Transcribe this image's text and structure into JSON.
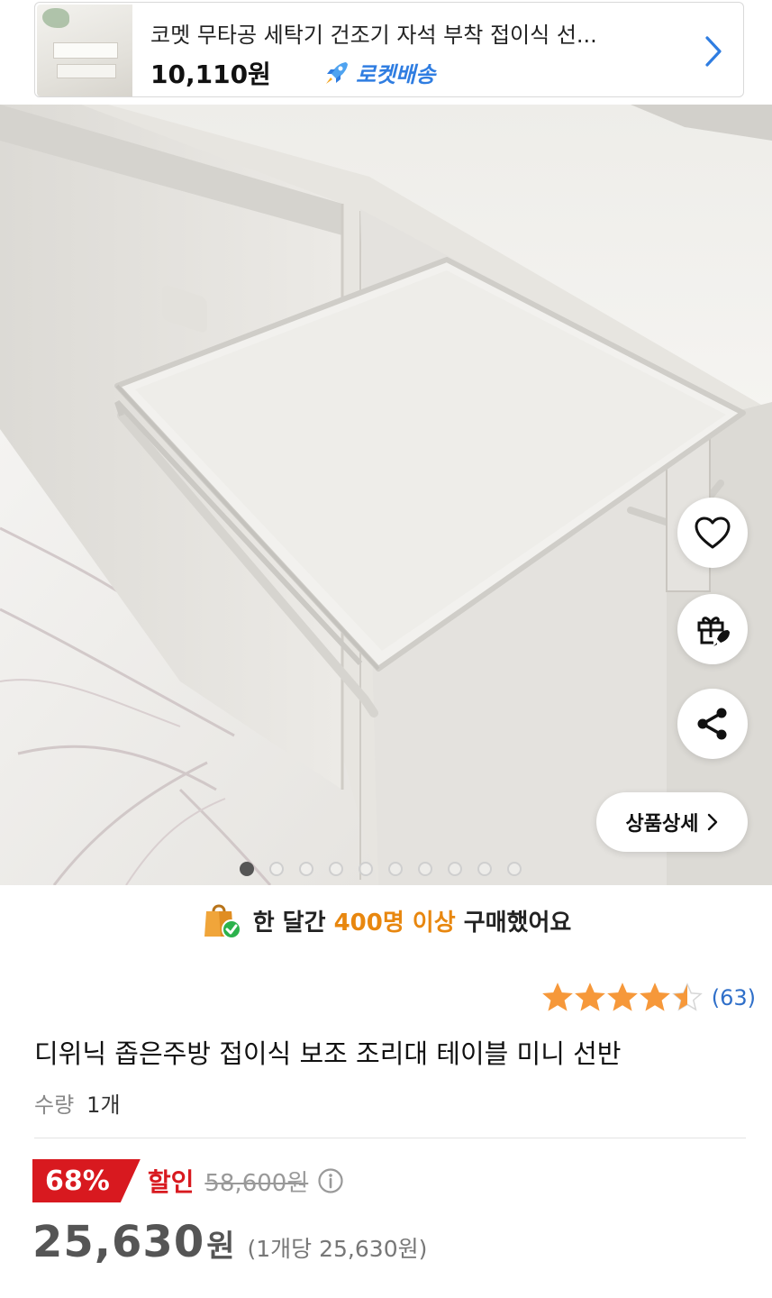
{
  "mini_bar": {
    "title": "코멧 무타공 세탁기 건조기 자석 부착 접이식 선...",
    "price": "10,110원",
    "rocket_label": "로켓배송",
    "chevron_color": "#2f7de1"
  },
  "gallery": {
    "total_images": 10,
    "active_index": 0,
    "detail_button_label": "상품상세"
  },
  "purchase_banner": {
    "prefix": "한 달간 ",
    "highlight": "400명 이상",
    "suffix": " 구매했어요",
    "highlight_color": "#e8870f"
  },
  "rating": {
    "stars": 4.5,
    "count_text": "(63)",
    "star_color": "#f6983a"
  },
  "product": {
    "title": "디위닉 좁은주방 접이식 보조 조리대 테이블 미니 선반",
    "qty_label": "수량",
    "qty_value": "1개"
  },
  "price": {
    "discount_rate": "68%",
    "sale_label": "할인",
    "original_price": "58,600원",
    "final_price": "25,630",
    "final_unit": "원",
    "unit_price_text": "(1개당 25,630원)",
    "discount_color": "#d8191f"
  }
}
